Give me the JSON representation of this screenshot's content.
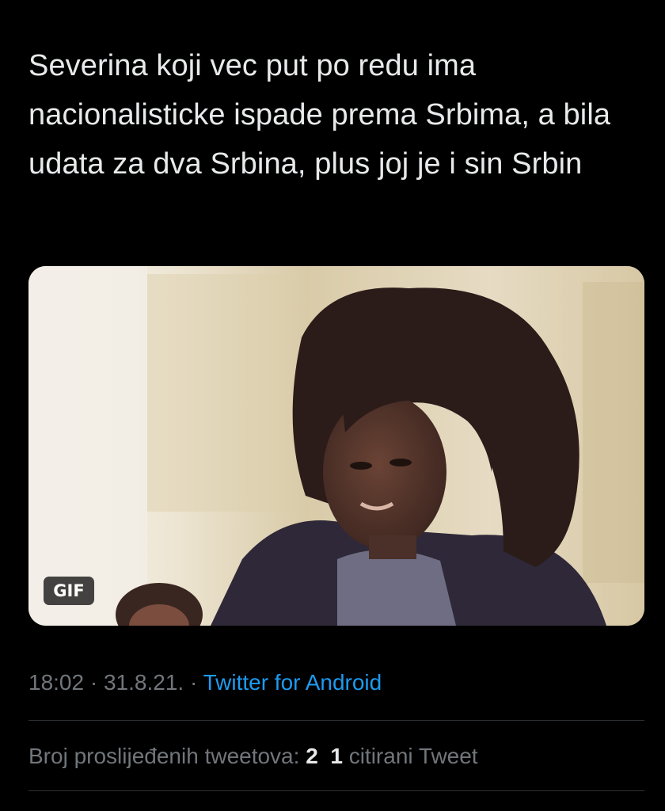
{
  "tweet": {
    "text": "Severina koji vec put po redu ima nacionalisticke ispade prema Srbima, a bila udata za dva Srbina, plus joj je i sin Srbin",
    "media": {
      "badge": "GIF"
    },
    "time": "18:02",
    "separator1": " · ",
    "date": "31.8.21.",
    "separator2": " · ",
    "source": "Twitter for Android"
  },
  "stats": {
    "retweets_label": "Broj proslijeđenih tweetova:",
    "retweets_count": "2",
    "quotes_count": "1",
    "quotes_label": "citirani Tweet"
  },
  "colors": {
    "background": "#000000",
    "text": "#e7e9ea",
    "secondary_text": "#71767b",
    "link": "#1d9bf0",
    "divider": "#2f3336"
  }
}
